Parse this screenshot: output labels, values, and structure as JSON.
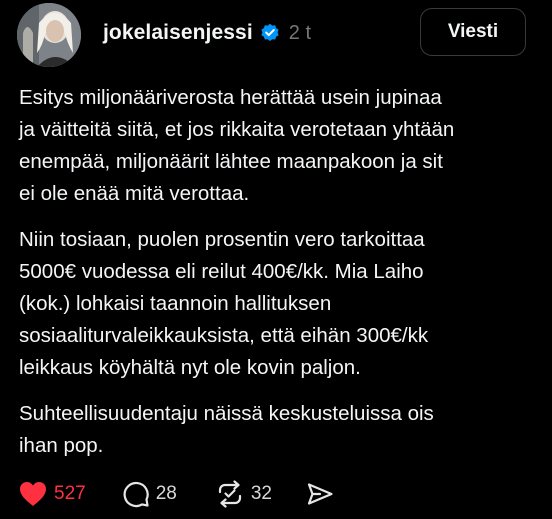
{
  "post": {
    "author": {
      "username": "jokelaisenjessi",
      "verified_icon": "verified-badge-icon",
      "time": "2 t"
    },
    "message_button": "Viesti",
    "paragraphs": [
      "Esitys miljonääriverosta herättää usein jupinaa\nja väitteitä siitä, et jos rikkaita verotetaan yhtään\nenempää, miljonäärit lähtee maanpakoon ja sit\nei ole enää mitä verottaa.",
      "Niin tosiaan, puolen prosentin vero tarkoittaa\n5000€ vuodessa eli reilut 400€/kk. Mia Laiho\n(kok.) lohkaisi taannoin hallituksen\nsosiaaliturvaleikkauksista, että eihän 300€/kk\nleikkaus köyhältä nyt ole kovin paljon.",
      "Suhteellisuudentaju näissä keskusteluissa ois\nihan pop."
    ],
    "actions": {
      "likes": "527",
      "replies": "28",
      "reposts": "32"
    }
  },
  "colors": {
    "background": "#000000",
    "text": "#f3f5f7",
    "muted": "#777777",
    "like_red": "#ff3040",
    "verified_blue": "#0095f6"
  }
}
